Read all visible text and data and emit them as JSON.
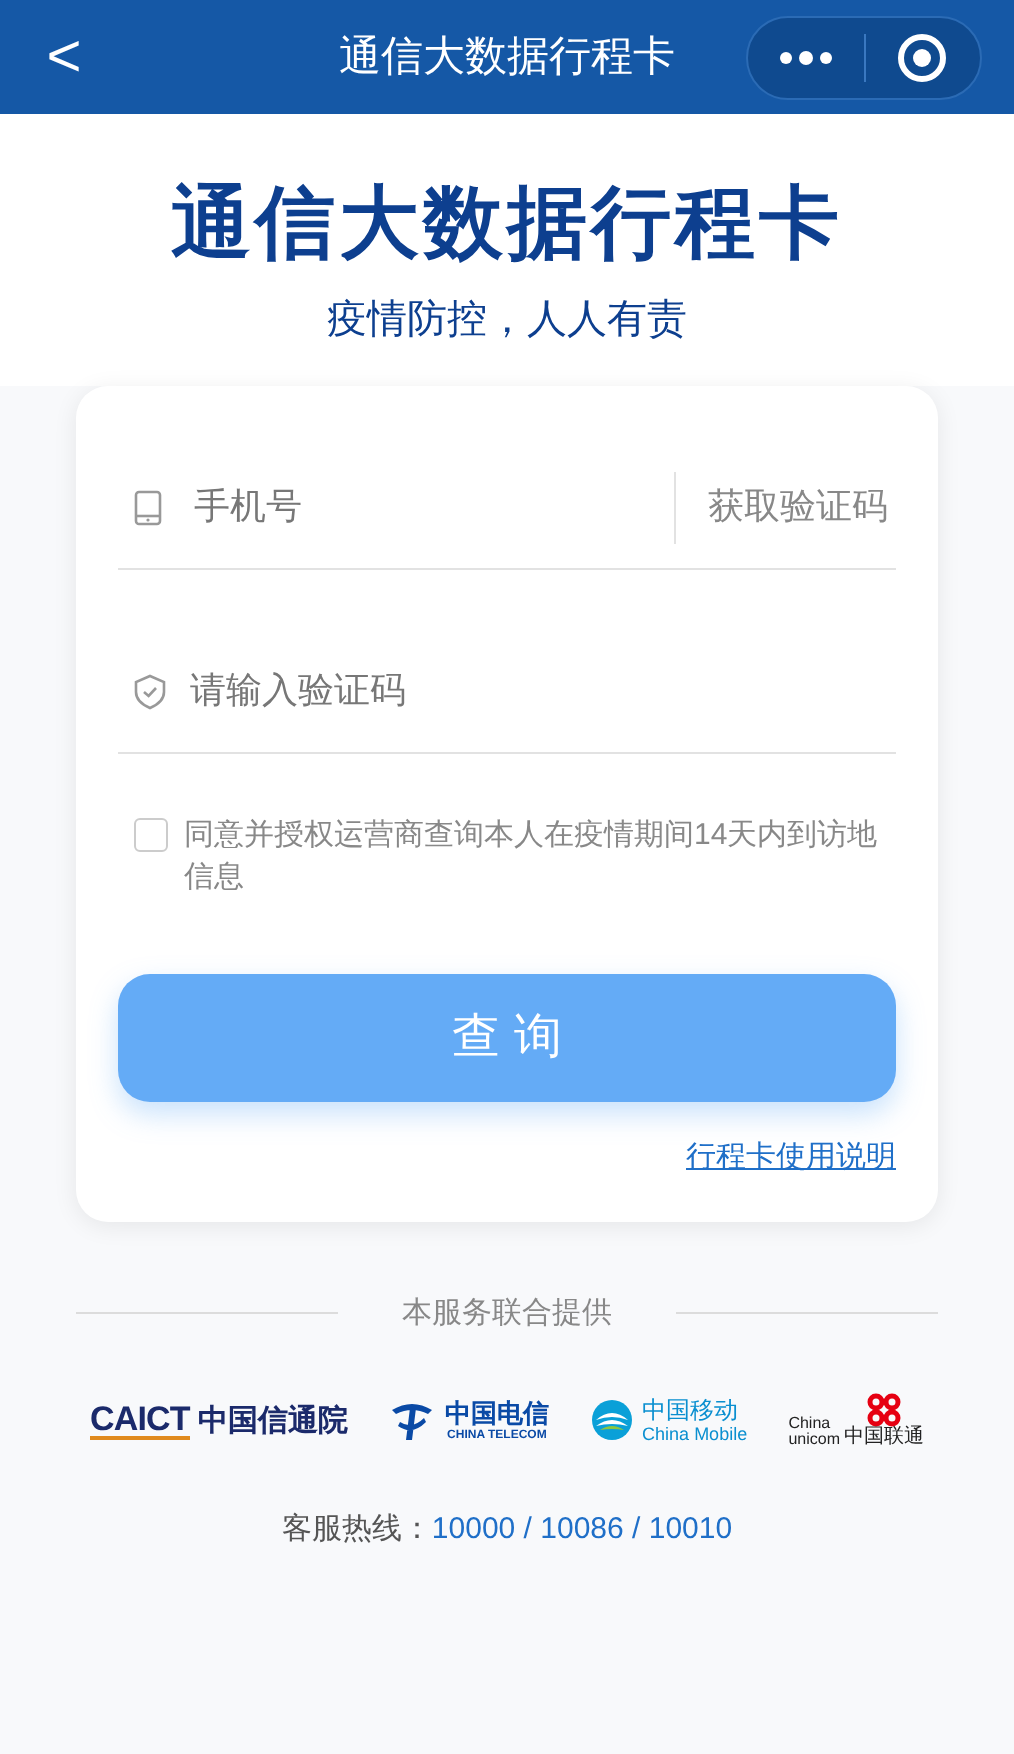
{
  "nav_bar": {
    "back": "<",
    "title": "通信大数据行程卡"
  },
  "hero": {
    "title": "通信大数据行程卡",
    "subtitle": "疫情防控，人人有责"
  },
  "form": {
    "phone": {
      "placeholder": "手机号"
    },
    "get_code": "获取验证码",
    "code": {
      "placeholder": "请输入验证码"
    },
    "consent": {
      "checked": false,
      "text": "同意并授权运营商查询本人在疫情期间14天内到访地信息"
    },
    "submit": "查 询",
    "help_link": "行程卡使用说明"
  },
  "providers": {
    "heading": "本服务联合提供",
    "logos": [
      {
        "kind": "caict",
        "lines": [
          "CAICT",
          "中国信通院"
        ]
      },
      {
        "kind": "telecom",
        "lines": [
          "中国电信",
          "CHINA TELECOM"
        ]
      },
      {
        "kind": "mobile",
        "lines": [
          "中国移动",
          "China Mobile"
        ]
      },
      {
        "kind": "unicom",
        "lines": [
          "China",
          "unicom",
          "中国联通"
        ]
      }
    ]
  },
  "hotline": {
    "label": "客服热线：",
    "numbers": "10000 / 10086 / 10010"
  }
}
